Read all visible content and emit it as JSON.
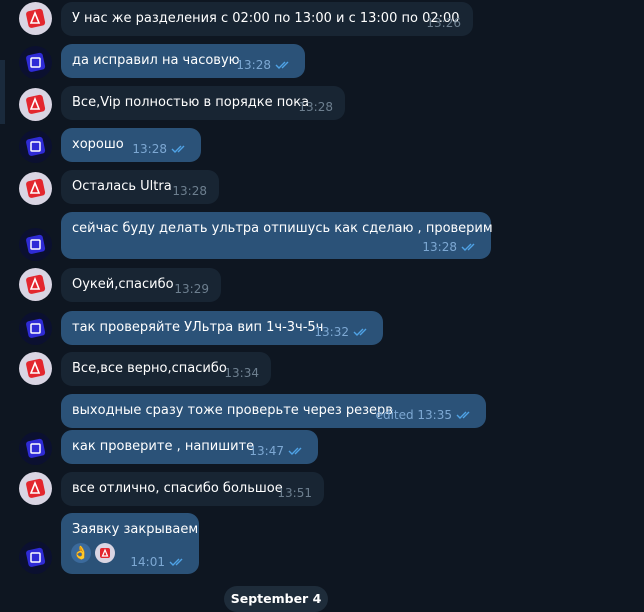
{
  "messages": [
    {
      "text": "У нас же разделения с 02:00 по 13:00 и с 13:00 по 02:00",
      "time": "13:26"
    },
    {
      "text": "да исправил на часовую",
      "time": "13:28"
    },
    {
      "text": "Все,Vip полностью в порядке пока",
      "time": "13:28"
    },
    {
      "text": "хорошо",
      "time": "13:28"
    },
    {
      "text": "Осталась Ultra",
      "time": "13:28"
    },
    {
      "text": "сейчас буду делать ультра отпишусь как сделаю , проверим",
      "time": "13:28"
    },
    {
      "text": "Оукей,спасибо",
      "time": "13:29"
    },
    {
      "text": "так проверяйте УЛьтра вип 1ч-3ч-5ч",
      "time": "13:32"
    },
    {
      "text": "Все,все верно,спасибо",
      "time": "13:34"
    },
    {
      "text": "выходные сразу тоже проверьте через резерв",
      "time": "edited 13:35"
    },
    {
      "text": "как проверите , напишите",
      "time": "13:47"
    },
    {
      "text": "все отлично, спасибо большое",
      "time": "13:51"
    },
    {
      "text": "Заявку закрываем",
      "time": "14:01",
      "reactions": [
        "👌"
      ]
    }
  ],
  "date_separator": "September 4",
  "colors": {
    "background": "#0e1621",
    "incoming": "#182533",
    "outgoing": "#2b5278",
    "accent_read": "#4fa3e6"
  }
}
